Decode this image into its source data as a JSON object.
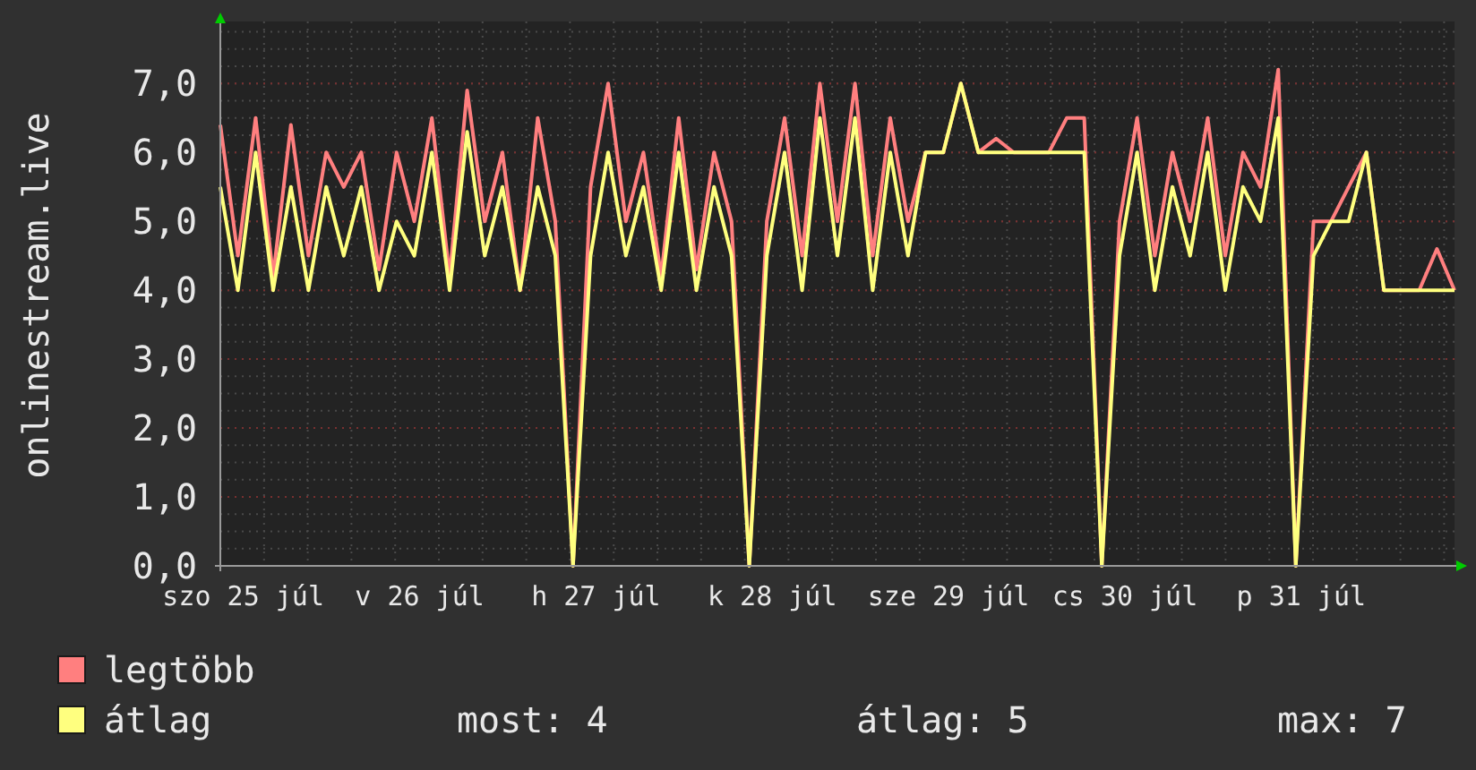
{
  "chart": {
    "chart_data": {
      "type": "line",
      "ylabel": "onlinestream.live",
      "ylim": [
        0,
        7.9
      ],
      "categories": [
        null,
        "szo 25 júl",
        null,
        null,
        null,
        null,
        null,
        null,
        null,
        null,
        null,
        "v 26 júl",
        null,
        null,
        null,
        null,
        null,
        null,
        null,
        null,
        null,
        "h 27 júl",
        null,
        null,
        null,
        null,
        null,
        null,
        null,
        null,
        null,
        "k 28 júl",
        null,
        null,
        null,
        null,
        null,
        null,
        null,
        null,
        null,
        "sze 29 júl",
        null,
        null,
        null,
        null,
        null,
        null,
        null,
        null,
        null,
        "cs 30 júl",
        null,
        null,
        null,
        null,
        null,
        null,
        null,
        null,
        null,
        "p 31 júl",
        null,
        null,
        null,
        null,
        null,
        null,
        null,
        null,
        null
      ],
      "series": [
        {
          "name": "legtöbb",
          "color": "#ff7f7f",
          "values": [
            6.4,
            4.5,
            6.5,
            4.2,
            6.4,
            4.5,
            6.0,
            5.5,
            6.0,
            4.3,
            6.0,
            5.0,
            6.5,
            4.2,
            6.9,
            5.0,
            6.0,
            4.0,
            6.5,
            5.0,
            0,
            5.5,
            7.0,
            5.0,
            6.0,
            4.2,
            6.5,
            4.3,
            6.0,
            5.0,
            0,
            5.0,
            6.5,
            4.5,
            7.0,
            5.0,
            7.0,
            4.5,
            6.5,
            5.0,
            6.0,
            6.0,
            7.0,
            6.0,
            6.2,
            6.0,
            6.0,
            6.0,
            6.5,
            6.5,
            0,
            5.0,
            6.5,
            4.5,
            6.0,
            5.0,
            6.5,
            4.5,
            6.0,
            5.5,
            7.2,
            0,
            5.0,
            5.0,
            5.5,
            6.0,
            4.0,
            4.0,
            4.0,
            4.6,
            4.0
          ]
        },
        {
          "name": "átlag",
          "color": "#ffff7f",
          "values": [
            5.5,
            4.0,
            6.0,
            4.0,
            5.5,
            4.0,
            5.5,
            4.5,
            5.5,
            4.0,
            5.0,
            4.5,
            6.0,
            4.0,
            6.3,
            4.5,
            5.5,
            4.0,
            5.5,
            4.5,
            0,
            4.5,
            6.0,
            4.5,
            5.5,
            4.0,
            6.0,
            4.0,
            5.5,
            4.5,
            0,
            4.5,
            6.0,
            4.0,
            6.5,
            4.5,
            6.5,
            4.0,
            6.0,
            4.5,
            6.0,
            6.0,
            7.0,
            6.0,
            6.0,
            6.0,
            6.0,
            6.0,
            6.0,
            6.0,
            0,
            4.5,
            6.0,
            4.0,
            5.5,
            4.5,
            6.0,
            4.0,
            5.5,
            5.0,
            6.5,
            0,
            4.5,
            5.0,
            5.0,
            6.0,
            4.0,
            4.0,
            4.0,
            4.0,
            4.0
          ]
        }
      ],
      "yticks": [
        {
          "value": 0,
          "label": "0,0"
        },
        {
          "value": 1,
          "label": "1,0"
        },
        {
          "value": 2,
          "label": "2,0"
        },
        {
          "value": 3,
          "label": "3,0"
        },
        {
          "value": 4,
          "label": "4,0"
        },
        {
          "value": 5,
          "label": "5,0"
        },
        {
          "value": 6,
          "label": "6,0"
        },
        {
          "value": 7,
          "label": "7,0"
        }
      ],
      "grid": true
    }
  },
  "stats": [
    "most: 4",
    "átlag: 5",
    "max: 7"
  ]
}
